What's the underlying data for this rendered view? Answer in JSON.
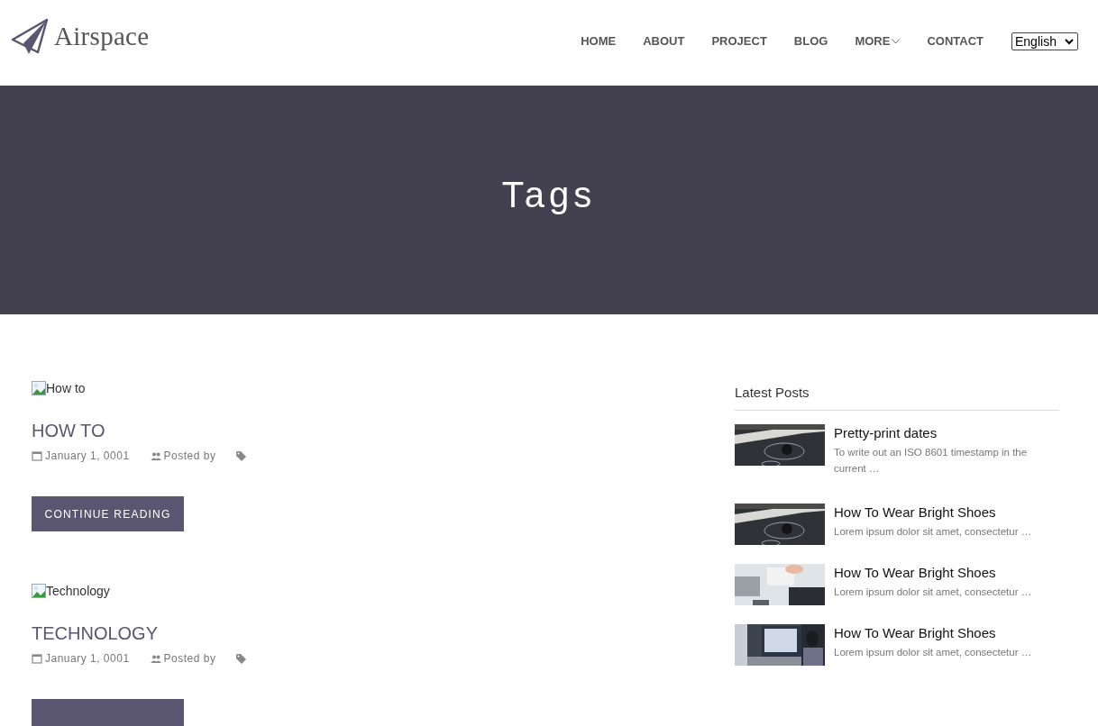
{
  "header": {
    "logo_text": "Airspace",
    "nav": [
      {
        "label": "HOME",
        "has_dropdown": false
      },
      {
        "label": "ABOUT",
        "has_dropdown": false
      },
      {
        "label": "PROJECT",
        "has_dropdown": false
      },
      {
        "label": "BLOG",
        "has_dropdown": false
      },
      {
        "label": "MORE",
        "has_dropdown": true
      },
      {
        "label": "CONTACT",
        "has_dropdown": false
      }
    ],
    "language_select": {
      "value": "English"
    }
  },
  "hero": {
    "title": "Tags"
  },
  "posts": [
    {
      "image_alt": "How to",
      "title": "HOW TO",
      "date": "January 1, 0001",
      "posted_by": "Posted by",
      "button": "CONTINUE READING"
    },
    {
      "image_alt": "Technology",
      "title": "TECHNOLOGY",
      "date": "January 1, 0001",
      "posted_by": "Posted by"
    }
  ],
  "sidebar": {
    "title": "Latest Posts",
    "posts": [
      {
        "title": "Pretty-print dates",
        "excerpt": "To write out an ISO 8601 timestamp in the current …",
        "kind": "picture"
      },
      {
        "title": "How To Wear Bright Shoes",
        "excerpt": "Lorem ipsum dolor sit amet, consectetur …",
        "kind": "picture"
      },
      {
        "title": "How To Wear Bright Shoes",
        "excerpt": "Lorem ipsum dolor sit amet, consectetur …",
        "kind": "picture"
      },
      {
        "title": "How To Wear Bright Shoes",
        "excerpt": "Lorem ipsum dolor sit amet, consectetur …",
        "kind": "picture"
      }
    ]
  }
}
